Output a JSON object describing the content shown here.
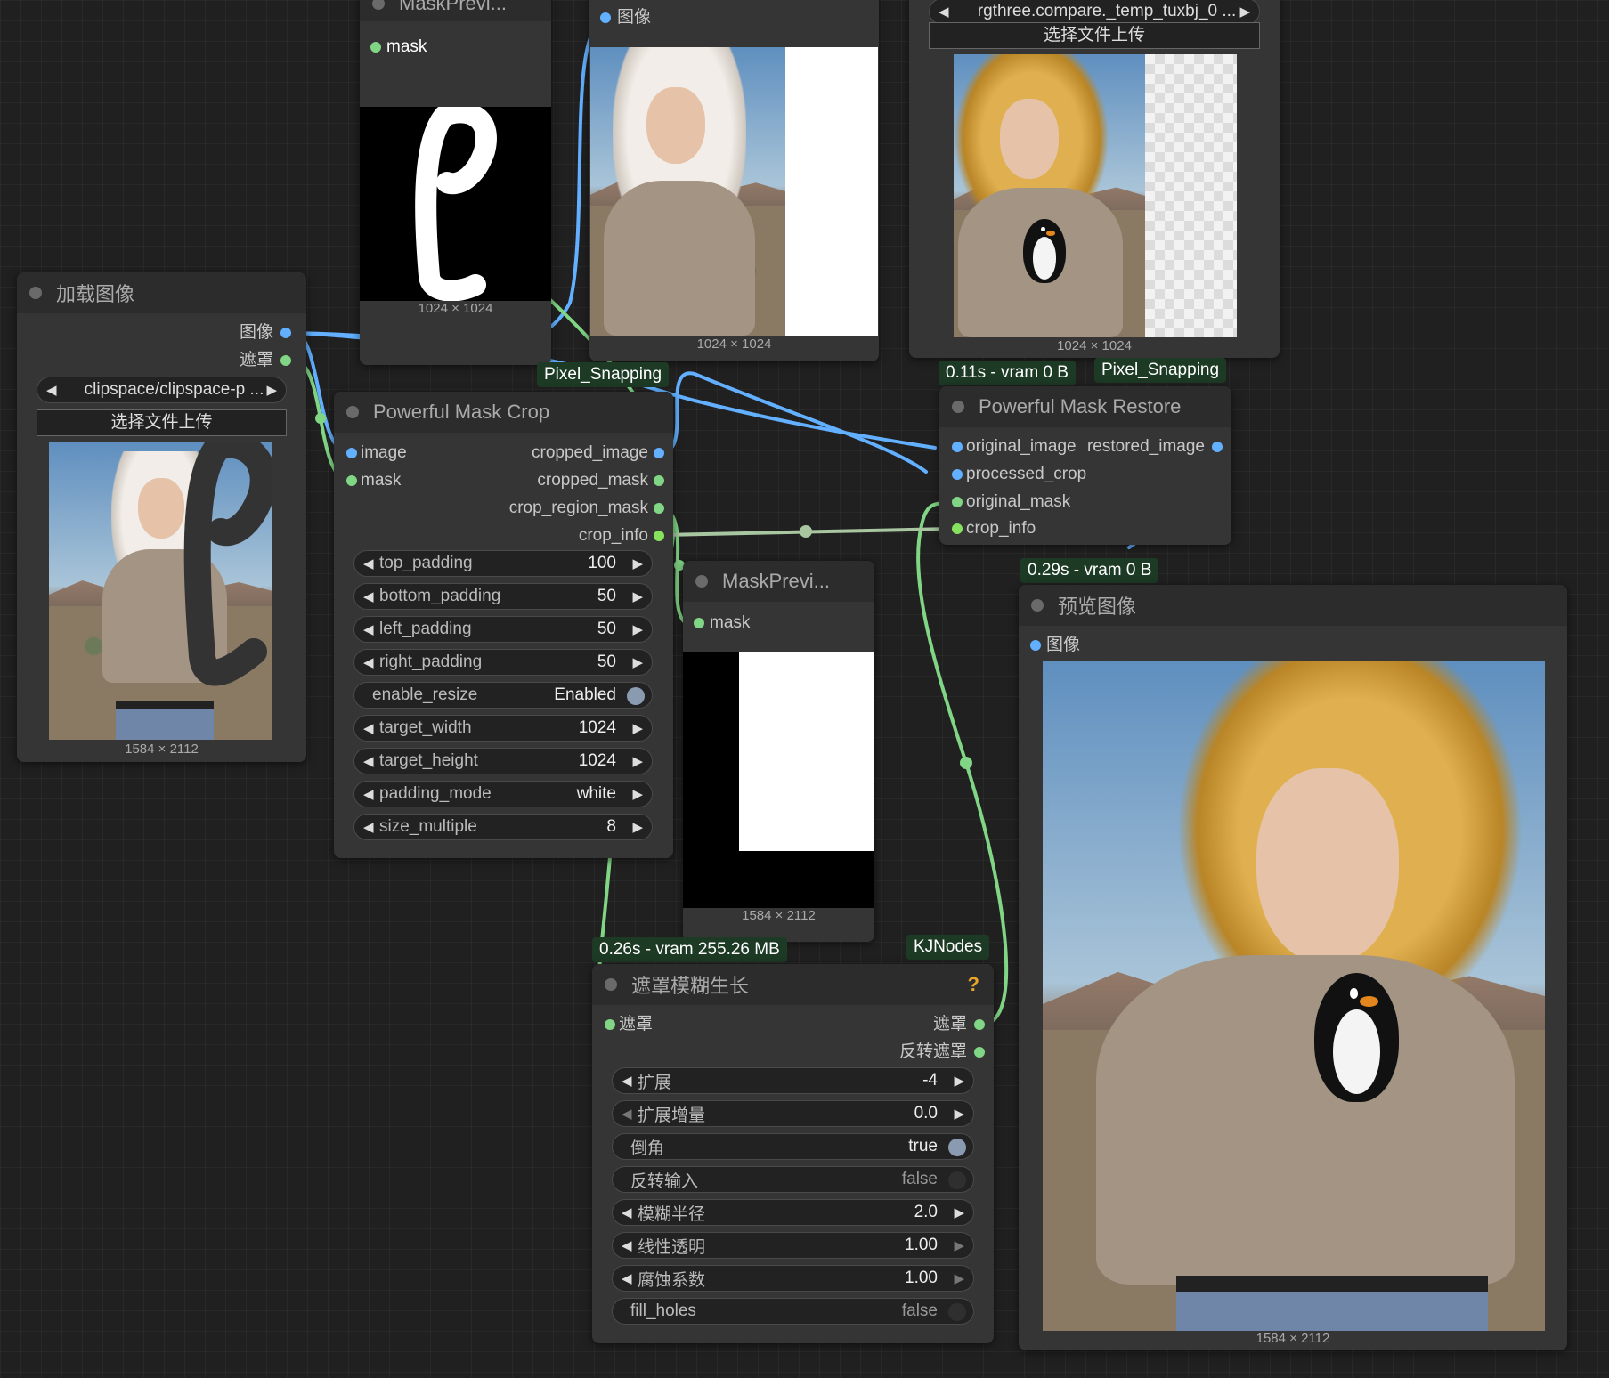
{
  "nodes": {
    "load_image": {
      "title": "加载图像",
      "outputs": [
        "图像",
        "遮罩"
      ],
      "file_combo": "clipspace/clipspace-p ...",
      "upload_label": "选择文件上传",
      "dims": "1584 × 2112"
    },
    "mask_preview_top": {
      "title": "MaskPrevi...",
      "input": "mask",
      "dims": "1024 × 1024"
    },
    "image_preview_top": {
      "input": "图像",
      "dims": "1024 × 1024"
    },
    "compare_node": {
      "file_combo": "rgthree.compare._temp_tuxbj_0 ...",
      "upload_label": "选择文件上传",
      "dims": "1024 × 1024"
    },
    "mask_crop": {
      "title": "Powerful Mask Crop",
      "badge": "Pixel_Snapping",
      "inputs": [
        "image",
        "mask"
      ],
      "outputs": [
        "cropped_image",
        "cropped_mask",
        "crop_region_mask",
        "crop_info"
      ],
      "widgets": [
        {
          "label": "top_padding",
          "value": "100"
        },
        {
          "label": "bottom_padding",
          "value": "50"
        },
        {
          "label": "left_padding",
          "value": "50"
        },
        {
          "label": "right_padding",
          "value": "50"
        },
        {
          "label": "enable_resize",
          "value": "Enabled"
        },
        {
          "label": "target_width",
          "value": "1024"
        },
        {
          "label": "target_height",
          "value": "1024"
        },
        {
          "label": "padding_mode",
          "value": "white"
        },
        {
          "label": "size_multiple",
          "value": "8"
        }
      ]
    },
    "mask_restore": {
      "title": "Powerful Mask Restore",
      "badge_time": "0.11s - vram 0 B",
      "badge_pack": "Pixel_Snapping",
      "inputs": [
        "original_image",
        "processed_crop",
        "original_mask",
        "crop_info"
      ],
      "output": "restored_image"
    },
    "mask_preview_mid": {
      "title": "MaskPrevi...",
      "input": "mask",
      "dims": "1584 × 2112"
    },
    "preview_image": {
      "title": "预览图像",
      "badge_time": "0.29s - vram 0 B",
      "input": "图像",
      "dims": "1584 × 2112"
    },
    "mask_blur": {
      "title": "遮罩模糊生长",
      "badge_time": "0.26s - vram 255.26 MB",
      "badge_pack": "KJNodes",
      "help": "?",
      "input": "遮罩",
      "outputs": [
        "遮罩",
        "反转遮罩"
      ],
      "widgets": [
        {
          "label": "扩展",
          "value": "-4"
        },
        {
          "label": "扩展增量",
          "value": "0.0"
        },
        {
          "label": "倒角",
          "value": "true"
        },
        {
          "label": "反转输入",
          "value": "false"
        },
        {
          "label": "模糊半径",
          "value": "2.0"
        },
        {
          "label": "线性透明",
          "value": "1.00"
        },
        {
          "label": "腐蚀系数",
          "value": "1.00"
        },
        {
          "label": "fill_holes",
          "value": "false"
        }
      ]
    }
  },
  "colors": {
    "image_link": "#62b0ff",
    "mask_link": "#81d685",
    "info_link": "#a8c6a0",
    "badge_bg": "#1d3a25"
  }
}
